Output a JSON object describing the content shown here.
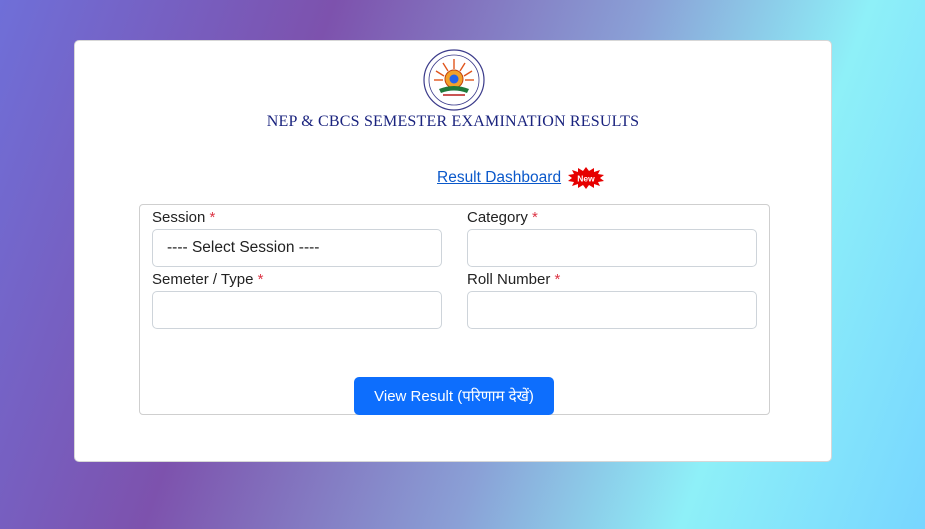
{
  "header": {
    "title": "NEP & CBCS SEMESTER EXAMINATION RESULTS"
  },
  "dashboard": {
    "link_label": "Result Dashboard",
    "badge_label": "New",
    "badge_color": "#e60000"
  },
  "form": {
    "session": {
      "label": "Session",
      "required_mark": "*",
      "value": "---- Select Session ----"
    },
    "category": {
      "label": "Category",
      "required_mark": "*",
      "value": ""
    },
    "semester": {
      "label": "Semeter / Type",
      "required_mark": "*",
      "value": ""
    },
    "roll": {
      "label": "Roll Number",
      "required_mark": "*",
      "value": ""
    },
    "submit_label": "View Result (परिणाम देखें)"
  },
  "colors": {
    "accent": "#0d6efd",
    "title": "#1a237e",
    "required": "#dc3545"
  }
}
